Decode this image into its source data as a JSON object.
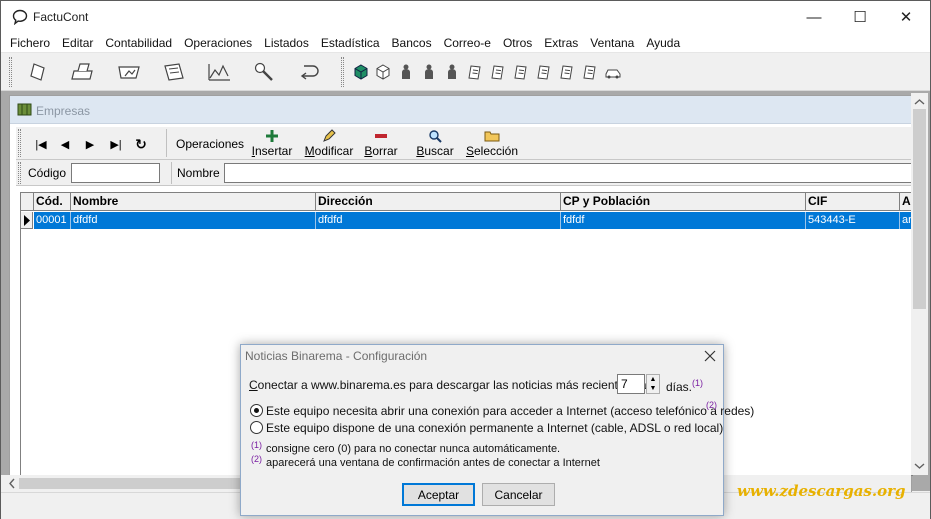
{
  "app": {
    "title": "FactuCont"
  },
  "window_controls": {
    "minimize": "—",
    "maximize": "☐",
    "close": "✕"
  },
  "menu": [
    "Fichero",
    "Editar",
    "Contabilidad",
    "Operaciones",
    "Listados",
    "Estadística",
    "Bancos",
    "Correo-e",
    "Otros",
    "Extras",
    "Ventana",
    "Ayuda"
  ],
  "toolbar_icons": [
    "new-document-icon",
    "printer-icon",
    "export-icon",
    "cards-icon",
    "chart-icon",
    "tools-icon",
    "undo-icon",
    "cube-green-icon",
    "cube-icon",
    "person-icon",
    "person-icon",
    "person-icon",
    "book-icon",
    "book-icon",
    "book-icon",
    "book-icon",
    "book-icon",
    "book-icon",
    "car-icon",
    "truck-icon"
  ],
  "child": {
    "title": "Empresas",
    "nav": {
      "first": "|◀",
      "prev": "◀",
      "next": "▶",
      "last": "▶|",
      "refresh": "↻"
    },
    "operations_label": "Operaciones",
    "operations": [
      {
        "key": "I",
        "rest": "nsertar"
      },
      {
        "key": "M",
        "rest": "odificar"
      },
      {
        "key": "B",
        "rest": "orrar"
      },
      {
        "key": "B",
        "rest": "uscar"
      },
      {
        "key": "S",
        "rest": "elección"
      }
    ],
    "filter": {
      "codigo_label": "Código",
      "nombre_label": "Nombre"
    },
    "grid": {
      "columns": [
        "Cód.",
        "Nombre",
        "Dirección",
        "CP y Población",
        "CIF",
        "Ac"
      ],
      "rows": [
        [
          "00001",
          "dfdfd",
          "dfdfd",
          "fdfdf",
          "543443-E",
          "ar"
        ]
      ]
    }
  },
  "dialog": {
    "title": "Noticias Binarema - Configuración",
    "connect_pre": "onectar a www.binarema.es para descargar las noticias más recientes cada",
    "connect_key": "C",
    "days_value": "7",
    "days_label": "días.",
    "mark1": "(1)",
    "mark2": "(2)",
    "option1": "Este equipo necesita abrir una conexión para acceder a Internet (acceso telefónico a redes)",
    "option2": "Este equipo dispone de una conexión permanente a Internet (cable, ADSL o red local)",
    "note1": "consigne cero (0) para no conectar nunca automáticamente.",
    "note2": "aparecerá una ventana de confirmación antes de conectar a Internet",
    "accept": "Aceptar",
    "cancel": "Cancelar"
  },
  "watermark": "www.zdescargas.org",
  "colors": {
    "selection": "#0078d7",
    "note_mark": "#7a1fa2",
    "watermark": "#e8b100"
  }
}
